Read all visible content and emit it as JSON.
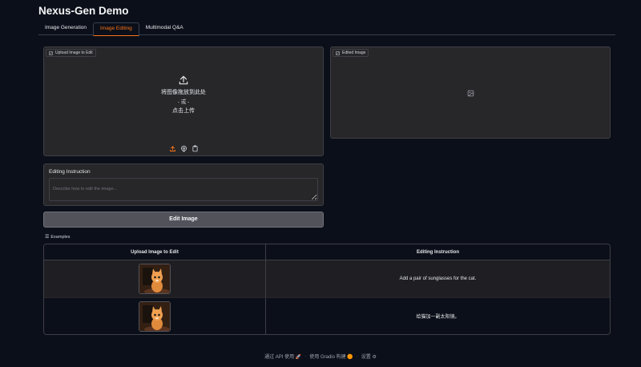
{
  "app": {
    "title": "Nexus-Gen Demo"
  },
  "tabs": [
    {
      "label": "Image Generation",
      "active": false
    },
    {
      "label": "Image Editing",
      "active": true
    },
    {
      "label": "Multimodal Q&A",
      "active": false
    }
  ],
  "upload": {
    "label": "Upload Image to Edit",
    "drop_text": "将图像拖放到此处",
    "or_text": "- 或 -",
    "click_text": "点击上传",
    "tool_icons": [
      "upload-icon",
      "webcam-icon",
      "clipboard-icon"
    ]
  },
  "output": {
    "label": "Edited Image",
    "placeholder_icon": "image-icon"
  },
  "instruction": {
    "label": "Editing Instruction",
    "placeholder": "Describe how to edit the image...",
    "value": ""
  },
  "edit_button": {
    "label": "Edit Image"
  },
  "examples": {
    "label": "Examples",
    "headers": [
      "Upload Image to Edit",
      "Editing Instruction"
    ],
    "rows": [
      {
        "image": "cat-thumbnail",
        "instruction": "Add a pair of sunglasses for the cat."
      },
      {
        "image": "cat-thumbnail",
        "instruction": "给猫加一副太阳镜。"
      }
    ]
  },
  "footer": {
    "api_text": "通过 API 使用",
    "built_text": "使用 Gradio 构建",
    "settings_text": "设置",
    "sep": "·"
  },
  "colors": {
    "accent": "#f97316",
    "background": "#0b0f19",
    "panel": "#27272a"
  }
}
